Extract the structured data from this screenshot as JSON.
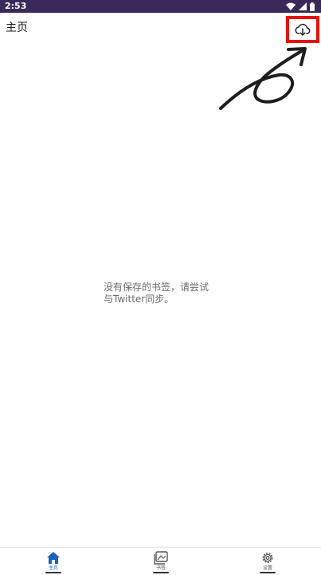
{
  "status_bar": {
    "time": "2:53",
    "background": "#3a2a5b",
    "icons": [
      "wifi-icon",
      "signal-icon",
      "battery-icon"
    ]
  },
  "app_bar": {
    "title": "主页",
    "sync_icon": "cloud-download-icon"
  },
  "annotation": {
    "highlight_color": "#e8120c",
    "arrow_icon": "hand-drawn-arrow-icon"
  },
  "empty_state": {
    "line1": "没有保存的书签，请尝试",
    "line2": "与Twitter同步。"
  },
  "bottom_nav": {
    "active_color": "#1565c0",
    "items": [
      {
        "label": "主页",
        "icon": "home-icon",
        "active": true
      },
      {
        "label": "书签",
        "icon": "gallery-icon",
        "active": false
      },
      {
        "label": "设置",
        "icon": "gear-icon",
        "active": false
      }
    ]
  }
}
